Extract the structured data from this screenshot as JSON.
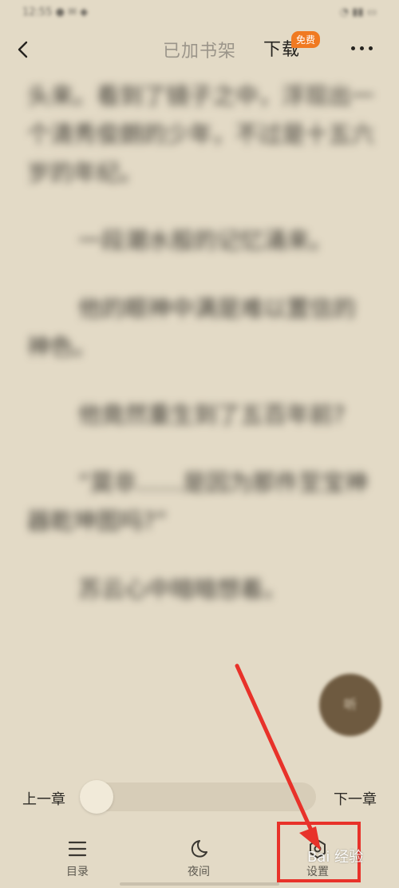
{
  "status_bar": {
    "left_text": "12:55 ● ✉ ◆",
    "right_text": "◔ ▮▮ ▭"
  },
  "top_bar": {
    "back_icon": "chevron-left-icon",
    "shelf_label": "已加书架",
    "download_label": "下载",
    "free_badge": "免费",
    "more_icon": "more-horizontal-icon"
  },
  "reader": {
    "paragraphs": [
      {
        "text": "头来。看到了镜子之中，浮现出一个清秀俊朗的少年，不过是十五六岁的年纪。",
        "indent": false
      },
      {
        "text": "一段潮水般的记忆涌来。",
        "indent": true
      },
      {
        "text": "他的眼神中满是难以置信的神色。",
        "indent": true
      },
      {
        "text": "他竟然重生到了五百年前?",
        "indent": true
      },
      {
        "text": "“莫非……是因为那件至宝神器乾坤图吗?”",
        "indent": true
      },
      {
        "text": "苏云心中暗暗想着。",
        "indent": true
      }
    ]
  },
  "audio_button": {
    "label": "听"
  },
  "progress": {
    "prev_label": "上一章",
    "next_label": "下一章",
    "position": 0.0
  },
  "bottom_nav": {
    "items": [
      {
        "label": "目录",
        "icon": "menu-icon"
      },
      {
        "label": "夜间",
        "icon": "moon-icon"
      },
      {
        "label": "设置",
        "icon": "settings-icon"
      }
    ]
  },
  "colors": {
    "background": "#e3dac6",
    "accent_badge": "#f07a22",
    "annotation": "#e8322a",
    "audio_fab": "#6e5a40"
  },
  "watermark": {
    "text": "Bai 经验"
  }
}
